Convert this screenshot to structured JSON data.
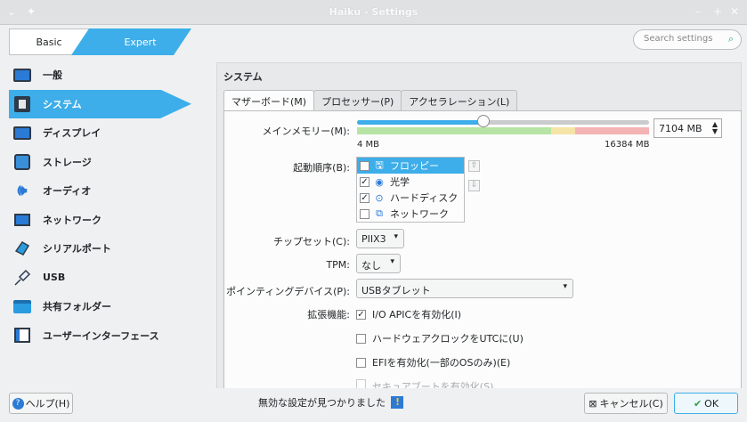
{
  "window": {
    "title": "Haiku - Settings",
    "menu_glyph": "⌄",
    "pin_glyph": "✦",
    "min_glyph": "–",
    "max_glyph": "+",
    "close_glyph": "✕"
  },
  "mode": {
    "basic": "Basic",
    "expert": "Expert",
    "selected": "Expert"
  },
  "search": {
    "placeholder": "Search settings",
    "icon": "⌕"
  },
  "sidebar": {
    "items": [
      {
        "label": "一般",
        "icon": "monitor-icon"
      },
      {
        "label": "システム",
        "icon": "chip-icon",
        "active": true
      },
      {
        "label": "ディスプレイ",
        "icon": "display-icon"
      },
      {
        "label": "ストレージ",
        "icon": "storage-icon"
      },
      {
        "label": "オーディオ",
        "icon": "speaker-icon"
      },
      {
        "label": "ネットワーク",
        "icon": "network-icon"
      },
      {
        "label": "シリアルポート",
        "icon": "serial-port-icon"
      },
      {
        "label": "USB",
        "icon": "usb-icon"
      },
      {
        "label": "共有フォルダー",
        "icon": "folder-icon"
      },
      {
        "label": "ユーザーインターフェース",
        "icon": "ui-icon"
      }
    ]
  },
  "section": {
    "title": "システム"
  },
  "tabs": [
    {
      "label": "マザーボード(M)",
      "active": true
    },
    {
      "label": "プロセッサー(P)"
    },
    {
      "label": "アクセラレーション(L)"
    }
  ],
  "memory": {
    "label": "メインメモリー(M):",
    "value": "7104 MB",
    "min_label": "4 MB",
    "max_label": "16384 MB",
    "fraction": 0.433,
    "spin_up": "▲",
    "spin_down": "▼"
  },
  "boot": {
    "label": "起動順序(B):",
    "items": [
      {
        "label": "フロッピー",
        "checked": false,
        "selected": true,
        "check": "",
        "glyph": "🖫",
        "icon": "floppy-icon"
      },
      {
        "label": "光学",
        "checked": true,
        "check": "✓",
        "glyph": "◉",
        "icon": "optical-icon"
      },
      {
        "label": "ハードディスク",
        "checked": true,
        "check": "✓",
        "glyph": "⊙",
        "icon": "hard-disk-icon"
      },
      {
        "label": "ネットワーク",
        "checked": false,
        "check": "",
        "glyph": "⧉",
        "icon": "network-icon"
      }
    ],
    "up": "⇧",
    "down": "⇩"
  },
  "chipset": {
    "label": "チップセット(C):",
    "value": "PIIX3",
    "arrow": "▾"
  },
  "tpm": {
    "label": "TPM:",
    "value": "なし",
    "arrow": "▾"
  },
  "pointing": {
    "label": "ポインティングデバイス(P):",
    "value": "USBタブレット",
    "arrow": "▾"
  },
  "extended": {
    "label": "拡張機能:",
    "options": [
      {
        "label": "I/O APICを有効化(I)",
        "checked": true,
        "check": "✓"
      },
      {
        "label": "ハードウェアクロックをUTCに(U)",
        "checked": false,
        "check": ""
      },
      {
        "label": "EFIを有効化(一部のOSのみ)(E)",
        "checked": false,
        "check": ""
      },
      {
        "label": "セキュアブートを有効化(S)",
        "checked": false,
        "disabled": true,
        "check": ""
      }
    ]
  },
  "footer": {
    "help": "ヘルプ(H)",
    "help_icon": "?",
    "status": "無効な設定が見つかりました",
    "cancel": "キャンセル(C)",
    "cancel_icon": "⊠",
    "ok": "OK",
    "ok_icon": "✔"
  },
  "colors": {
    "accent": "#3daee9",
    "background": "#eff0f1",
    "panel": "#fcfcfc"
  }
}
